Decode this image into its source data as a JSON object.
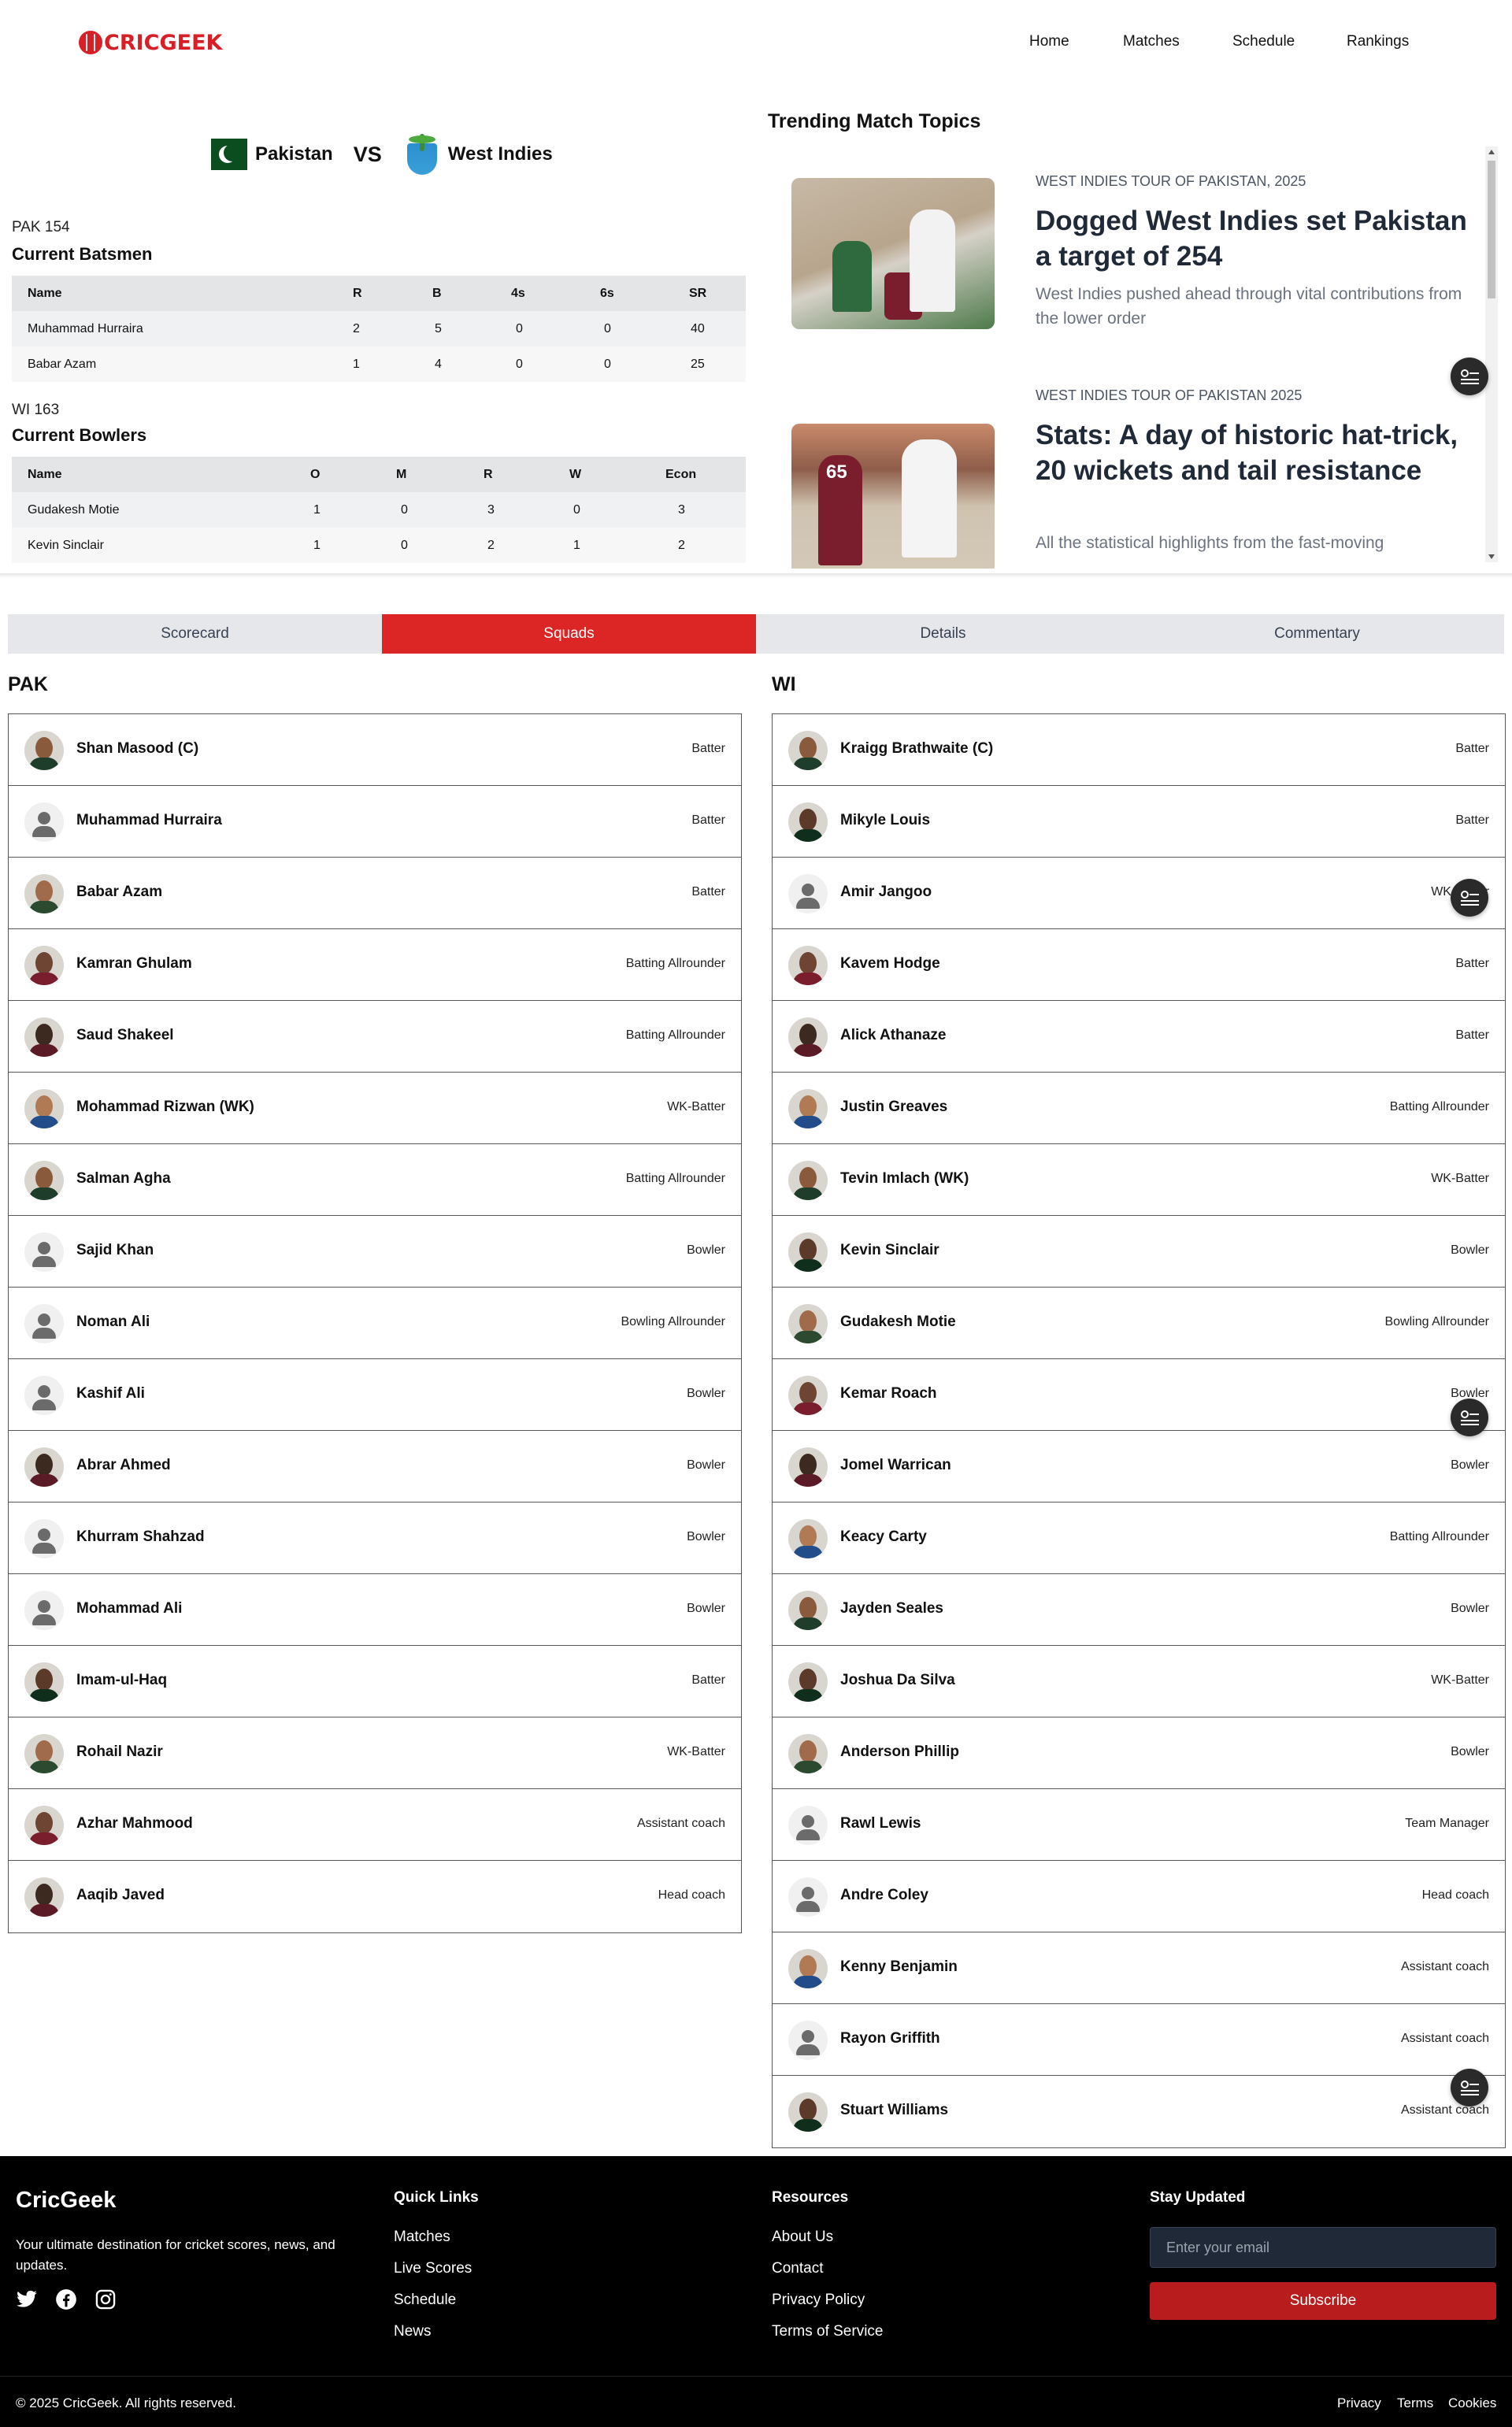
{
  "brand": {
    "logo_text": "CRICGEEK"
  },
  "nav": {
    "items": [
      "Home",
      "Matches",
      "Schedule",
      "Rankings"
    ]
  },
  "match": {
    "team1": "Pakistan",
    "team2": "West Indies",
    "vs": "VS",
    "batting_score": "PAK 154",
    "bowling_score": "WI 163"
  },
  "batsmen": {
    "title": "Current Batsmen",
    "headers": [
      "Name",
      "R",
      "B",
      "4s",
      "6s",
      "SR"
    ],
    "rows": [
      [
        "Muhammad Hurraira",
        "2",
        "5",
        "0",
        "0",
        "40"
      ],
      [
        "Babar Azam",
        "1",
        "4",
        "0",
        "0",
        "25"
      ]
    ]
  },
  "bowlers": {
    "title": "Current Bowlers",
    "headers": [
      "Name",
      "O",
      "M",
      "R",
      "W",
      "Econ"
    ],
    "rows": [
      [
        "Gudakesh Motie",
        "1",
        "0",
        "3",
        "0",
        "3"
      ],
      [
        "Kevin Sinclair",
        "1",
        "0",
        "2",
        "1",
        "2"
      ]
    ]
  },
  "trending": {
    "title": "Trending Match Topics",
    "items": [
      {
        "category": "WEST INDIES TOUR OF PAKISTAN, 2025",
        "headline": "Dogged West Indies set Pakistan a target of 254",
        "summary": "West Indies pushed ahead through vital contributions from the lower order"
      },
      {
        "category": "WEST INDIES TOUR OF PAKISTAN 2025",
        "headline": "Stats: A day of historic hat-trick, 20 wickets and tail resistance",
        "summary": "All the statistical highlights from the fast-moving"
      }
    ],
    "image_jersey_number": "65"
  },
  "tabs": [
    "Scorecard",
    "Squads",
    "Details",
    "Commentary"
  ],
  "active_tab": "Squads",
  "squads": {
    "pak": {
      "title": "PAK",
      "players": [
        {
          "name": "Shan Masood (C)",
          "role": "Batter",
          "avatar": "photo"
        },
        {
          "name": "Muhammad Hurraira",
          "role": "Batter",
          "avatar": "placeholder"
        },
        {
          "name": "Babar Azam",
          "role": "Batter",
          "avatar": "photo"
        },
        {
          "name": "Kamran Ghulam",
          "role": "Batting Allrounder",
          "avatar": "photo"
        },
        {
          "name": "Saud Shakeel",
          "role": "Batting Allrounder",
          "avatar": "photo"
        },
        {
          "name": "Mohammad Rizwan (WK)",
          "role": "WK-Batter",
          "avatar": "photo"
        },
        {
          "name": "Salman Agha",
          "role": "Batting Allrounder",
          "avatar": "photo"
        },
        {
          "name": "Sajid Khan",
          "role": "Bowler",
          "avatar": "placeholder"
        },
        {
          "name": "Noman Ali",
          "role": "Bowling Allrounder",
          "avatar": "placeholder"
        },
        {
          "name": "Kashif Ali",
          "role": "Bowler",
          "avatar": "placeholder"
        },
        {
          "name": "Abrar Ahmed",
          "role": "Bowler",
          "avatar": "photo"
        },
        {
          "name": "Khurram Shahzad",
          "role": "Bowler",
          "avatar": "placeholder"
        },
        {
          "name": "Mohammad Ali",
          "role": "Bowler",
          "avatar": "placeholder"
        },
        {
          "name": "Imam-ul-Haq",
          "role": "Batter",
          "avatar": "photo"
        },
        {
          "name": "Rohail Nazir",
          "role": "WK-Batter",
          "avatar": "photo"
        },
        {
          "name": "Azhar Mahmood",
          "role": "Assistant coach",
          "avatar": "photo"
        },
        {
          "name": "Aaqib Javed",
          "role": "Head coach",
          "avatar": "photo"
        }
      ]
    },
    "wi": {
      "title": "WI",
      "players": [
        {
          "name": "Kraigg Brathwaite (C)",
          "role": "Batter",
          "avatar": "photo"
        },
        {
          "name": "Mikyle Louis",
          "role": "Batter",
          "avatar": "photo"
        },
        {
          "name": "Amir Jangoo",
          "role": "WK-Batter",
          "avatar": "placeholder"
        },
        {
          "name": "Kavem Hodge",
          "role": "Batter",
          "avatar": "photo"
        },
        {
          "name": "Alick Athanaze",
          "role": "Batter",
          "avatar": "photo"
        },
        {
          "name": "Justin Greaves",
          "role": "Batting Allrounder",
          "avatar": "photo"
        },
        {
          "name": "Tevin Imlach (WK)",
          "role": "WK-Batter",
          "avatar": "photo"
        },
        {
          "name": "Kevin Sinclair",
          "role": "Bowler",
          "avatar": "photo"
        },
        {
          "name": "Gudakesh Motie",
          "role": "Bowling Allrounder",
          "avatar": "photo"
        },
        {
          "name": "Kemar Roach",
          "role": "Bowler",
          "avatar": "photo"
        },
        {
          "name": "Jomel Warrican",
          "role": "Bowler",
          "avatar": "photo"
        },
        {
          "name": "Keacy Carty",
          "role": "Batting Allrounder",
          "avatar": "photo"
        },
        {
          "name": "Jayden Seales",
          "role": "Bowler",
          "avatar": "photo"
        },
        {
          "name": "Joshua Da Silva",
          "role": "WK-Batter",
          "avatar": "photo"
        },
        {
          "name": "Anderson Phillip",
          "role": "Bowler",
          "avatar": "photo"
        },
        {
          "name": "Rawl Lewis",
          "role": "Team Manager",
          "avatar": "placeholder"
        },
        {
          "name": "Andre Coley",
          "role": "Head coach",
          "avatar": "placeholder"
        },
        {
          "name": "Kenny Benjamin",
          "role": "Assistant coach",
          "avatar": "photo"
        },
        {
          "name": "Rayon Griffith",
          "role": "Assistant coach",
          "avatar": "placeholder"
        },
        {
          "name": "Stuart Williams",
          "role": "Assistant coach",
          "avatar": "photo"
        }
      ]
    }
  },
  "footer": {
    "brand": "CricGeek",
    "description": "Your ultimate destination for cricket scores, news, and updates.",
    "social_icons": [
      "twitter-icon",
      "facebook-icon",
      "instagram-icon"
    ],
    "quick_links": {
      "title": "Quick Links",
      "items": [
        "Matches",
        "Live Scores",
        "Schedule",
        "News"
      ]
    },
    "resources": {
      "title": "Resources",
      "items": [
        "About Us",
        "Contact",
        "Privacy Policy",
        "Terms of Service"
      ]
    },
    "newsletter": {
      "title": "Stay Updated",
      "placeholder": "Enter your email",
      "button": "Subscribe"
    },
    "copyright": "© 2025 CricGeek. All rights reserved.",
    "bottom_links": [
      "Privacy",
      "Terms",
      "Cookies"
    ]
  },
  "colors": {
    "accent": "#dc2626",
    "footer_bg": "#000000",
    "tab_bg": "#e5e7eb"
  }
}
